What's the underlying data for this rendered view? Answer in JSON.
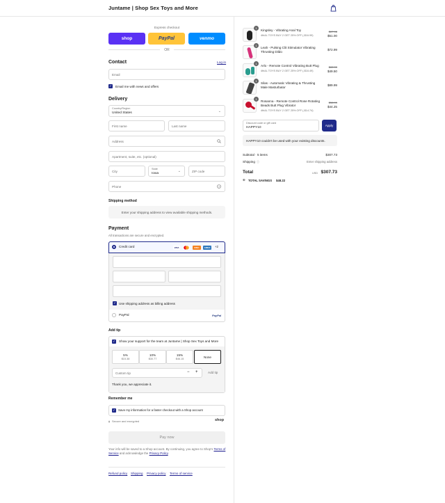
{
  "header": {
    "store_name": "Juntame | Shop Sex Toys and More",
    "cart_icon": "shopping-bag-icon"
  },
  "express": {
    "label": "Express checkout",
    "shop_label": "shop",
    "paypal_label": "PayPal",
    "venmo_label": "venmo",
    "or_label": "OR"
  },
  "contact": {
    "heading": "Contact",
    "login_link": "Log in",
    "email_placeholder": "Email",
    "news_label": "Email me with news and offers"
  },
  "delivery": {
    "heading": "Delivery",
    "country_label": "Country/Region",
    "country_value": "United States",
    "first_name": "First name",
    "last_name": "Last name",
    "address": "Address",
    "apartment": "Apartment, suite, etc. (optional)",
    "city": "City",
    "state_label": "State",
    "state_value": "Iowa",
    "zip": "ZIP code",
    "phone": "Phone"
  },
  "shipping": {
    "heading": "Shipping method",
    "note": "Enter your shipping address to view available shipping methods."
  },
  "payment": {
    "heading": "Payment",
    "subtext": "All transactions are secure and encrypted.",
    "credit_card_label": "Credit card",
    "more_cards": "+2",
    "billing_label": "Use shipping address as billing address",
    "paypal_label": "PayPal",
    "paypal_logo": "PayPal",
    "card_logos": [
      {
        "name": "VISA",
        "color": "#1a1f71"
      },
      {
        "name": "MC",
        "color": "#eb001b"
      },
      {
        "name": "DISC",
        "color": "#f58220"
      },
      {
        "name": "AMEX",
        "color": "#2e77bc"
      }
    ]
  },
  "tip": {
    "heading": "Add tip",
    "support_label": "Show your support for the team at Juntame | Shop Sex Toys and More",
    "options": [
      {
        "pct": "5%",
        "amount": "$15.38"
      },
      {
        "pct": "10%",
        "amount": "$30.77"
      },
      {
        "pct": "15%",
        "amount": "$46.15"
      },
      {
        "pct": "None",
        "amount": ""
      }
    ],
    "custom_placeholder": "Custom tip",
    "minus": "−",
    "plus": "+",
    "add_button": "Add tip",
    "thanks": "Thank you, we appreciate it."
  },
  "remember": {
    "heading": "Remember me",
    "save_label": "Save my information for a faster checkout with a Shop account",
    "secure_text": "Secure and encrypted",
    "shop_logo": "shop"
  },
  "pay_now": "Pay now",
  "legal": {
    "line1": "Your info will be saved to a Shop account. By continuing, you agree to Shop's",
    "terms": "Terms of Service",
    "and": "and acknowledge the",
    "privacy": "Privacy Policy",
    "period": "."
  },
  "footer": [
    "Refund policy",
    "Shipping",
    "Privacy policy",
    "Terms of service"
  ],
  "cart": {
    "items": [
      {
        "qty": "1",
        "name": "Kingsley - Vibrating Anal Toy",
        "discount": "4th&L TOYS BUY 2 GET 25% OFF (-$16.99)",
        "old_price": "$67.98",
        "price": "$51.00",
        "thumb_color": "#222222"
      },
      {
        "qty": "1",
        "name": "Leah - Pulsing Clit Stimulator Vibrating Thrusting Dildo",
        "discount": "",
        "old_price": "",
        "price": "$72.99",
        "thumb_color": "#d6327a"
      },
      {
        "qty": "1",
        "name": "Arlo - Remote Control Vibrating Butt Plug",
        "discount": "4th&L TOYS BUY 2 GET 25% OFF (-$16.49)",
        "old_price": "$65.99",
        "price": "$49.50",
        "thumb_color": "#2a9d8f"
      },
      {
        "qty": "1",
        "name": "Silas - Automatic Vibrating & Thrusting Male Masturbator",
        "discount": "",
        "old_price": "",
        "price": "$89.99",
        "thumb_color": "#444444"
      },
      {
        "qty": "1",
        "name": "Rosanna - Remote Control Rose Rotating Beads Butt Plug Vibrator",
        "discount": "4th&L TOYS BUY 2 GET 25% OFF (-$14.74)",
        "old_price": "$58.99",
        "price": "$44.25",
        "thumb_color": "#c8102e"
      }
    ],
    "discount_label": "Discount code or gift card",
    "discount_value": "HAPPY10",
    "apply": "Apply",
    "error": "HAPPY10 couldn't be used with your existing discounts.",
    "subtotal_label": "Subtotal · 5 items",
    "subtotal_value": "$307.73",
    "shipping_label": "Shipping",
    "shipping_value": "Enter shipping address",
    "total_label": "Total",
    "currency": "USD",
    "total_value": "$307.73",
    "savings_label": "TOTAL SAVINGS",
    "savings_value": "$48.22"
  }
}
